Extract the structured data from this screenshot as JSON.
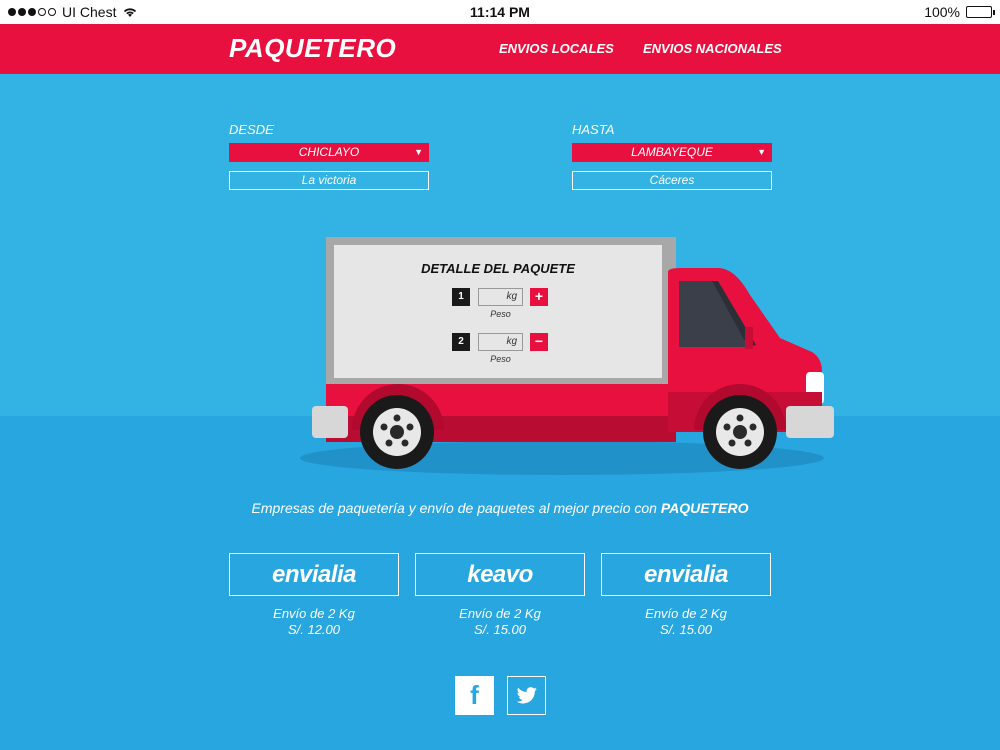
{
  "status_bar": {
    "carrier": "UI Chest",
    "time": "11:14 PM",
    "battery": "100%",
    "battery_level": 1.0,
    "signal_bars_filled": 3,
    "signal_bars_total": 5
  },
  "nav": {
    "brand": "PAQUETERO",
    "links": [
      "ENVIOS LOCALES",
      "ENVIOS NACIONALES"
    ]
  },
  "form": {
    "from": {
      "label": "DESDE",
      "city": "CHICLAYO",
      "district": "La victoria"
    },
    "to": {
      "label": "HASTA",
      "city": "LAMBAYEQUE",
      "district": "Cáceres"
    }
  },
  "package": {
    "title": "DETALLE DEL PAQUETE",
    "items": [
      {
        "number": "1",
        "unit": "kg",
        "caption": "Peso",
        "action": "+"
      },
      {
        "number": "2",
        "unit": "kg",
        "caption": "Peso",
        "action": "−"
      }
    ]
  },
  "tagline": {
    "text": "Empresas de paquetería y envío de paquetes al mejor precio con ",
    "brand": "PAQUETERO"
  },
  "carriers": [
    {
      "name": "envialia",
      "line1": "Envío de 2 Kg",
      "line2": "S/. 12.00"
    },
    {
      "name": "keavo",
      "line1": "Envío de 2 Kg",
      "line2": "S/. 15.00"
    },
    {
      "name": "envialia",
      "line1": "Envío de 2 Kg",
      "line2": "S/. 15.00"
    }
  ],
  "social": [
    "facebook-icon",
    "twitter-icon"
  ],
  "colors": {
    "primary_red": "#e8103e",
    "sky_blue": "#32b3e3",
    "floor_blue": "#28a6e0",
    "panel_gray": "#e6e6e6"
  }
}
